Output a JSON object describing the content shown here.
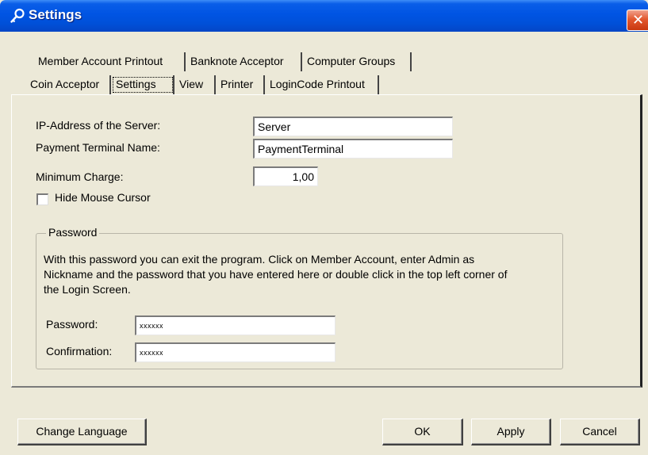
{
  "window": {
    "title": "Settings",
    "close_glyph": "✕"
  },
  "tabs": {
    "back_row": [
      "Member Account Printout",
      "Banknote Acceptor",
      "Computer Groups"
    ],
    "front_row": [
      "Coin Acceptor",
      "Settings",
      "View",
      "Printer",
      "LoginCode Printout"
    ],
    "selected": "Settings"
  },
  "settings": {
    "ip_label": "IP-Address of the Server:",
    "ip_value": "Server",
    "terminal_label": "Payment Terminal Name:",
    "terminal_value": "PaymentTerminal",
    "min_charge_label": "Minimum Charge:",
    "min_charge_value": "1,00",
    "hide_cursor_label": "Hide Mouse Cursor",
    "hide_cursor_checked": false
  },
  "password_group": {
    "legend": "Password",
    "description": "With this password you can exit the program. Click on Member Account, enter Admin as\nNickname and the password that you have entered here or double click in the top left corner of\nthe Login Screen.",
    "password_label": "Password:",
    "password_value": "xxxxxx",
    "confirmation_label": "Confirmation:",
    "confirmation_value": "xxxxxx"
  },
  "buttons": {
    "change_language": "Change Language",
    "ok": "OK",
    "apply": "Apply",
    "cancel": "Cancel"
  }
}
